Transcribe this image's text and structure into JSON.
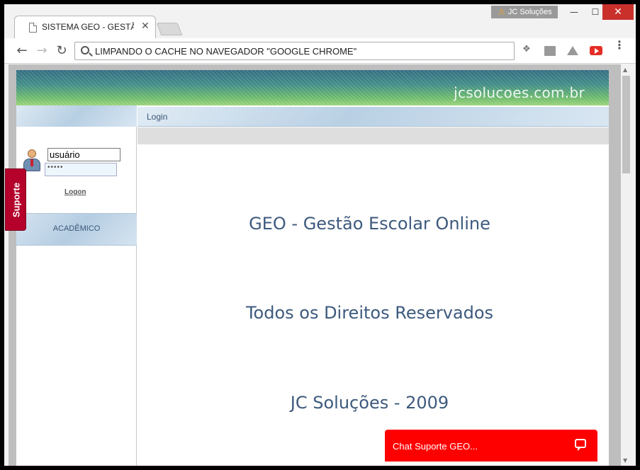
{
  "browser": {
    "profile_name": "JC Soluções",
    "profile_warning_glyph": "⚠",
    "tab_title": "SISTEMA GEO - GESTÃO",
    "tab_close_glyph": "✕",
    "window_controls": {
      "minimize": "—",
      "maximize": "☐",
      "close": "✕"
    },
    "nav": {
      "back": "←",
      "forward": "→",
      "reload": "↻"
    },
    "address": "LIMPANDO O CACHE NO NAVEGADOR \"GOOGLE CHROME\"",
    "extensions": [
      "dropbox-icon",
      "calendar-icon",
      "drive-icon",
      "youtube-icon"
    ],
    "menu_glyph": "⋮",
    "scroll": {
      "up": "▲",
      "down": "▼"
    }
  },
  "site": {
    "banner_domain": "jcsolucoes.com.br",
    "login": {
      "username_value": "usuário",
      "password_value": "•••••",
      "logon_label": "Logon"
    },
    "sidebar_menu": [
      {
        "label": "ACADÊMICO"
      }
    ],
    "breadcrumb": "Login",
    "content_lines": [
      "GEO - Gestão Escolar Online",
      "Todos os Direitos Reservados",
      "JC Soluções - 2009"
    ],
    "support_tab_label": "Suporte",
    "chat_label": "Chat Suporte GEO..."
  }
}
